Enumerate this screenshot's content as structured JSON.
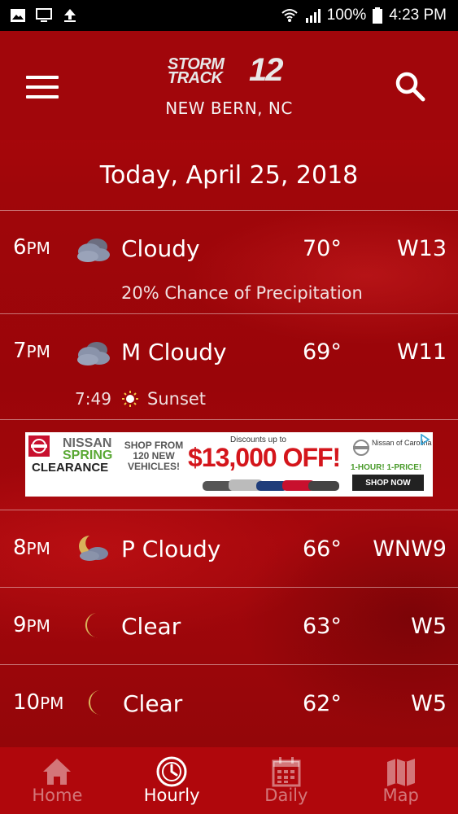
{
  "status_bar": {
    "battery": "100%",
    "time": "4:23 PM",
    "icons": [
      "image-icon",
      "monitor-icon",
      "upload-icon",
      "wifi-icon",
      "signal-icon",
      "battery-icon"
    ]
  },
  "header": {
    "logo_line1": "STORM",
    "logo_line2": "TRACK",
    "logo_number": "12",
    "location": "NEW BERN, NC"
  },
  "date_label": "Today, April 25, 2018",
  "hours": [
    {
      "hour": "6",
      "ampm": "PM",
      "icon": "partly-cloudy-icon",
      "condition": "Cloudy",
      "temp": "70°",
      "wind": "W13",
      "precip": "20% Chance of Precipitation"
    },
    {
      "hour": "7",
      "ampm": "PM",
      "icon": "partly-cloudy-icon",
      "condition": "M Cloudy",
      "temp": "69°",
      "wind": "W11",
      "sunset_time": "7:49",
      "sunset_label": "Sunset"
    },
    {
      "hour": "8",
      "ampm": "PM",
      "icon": "moon-cloud-icon",
      "condition": "P Cloudy",
      "temp": "66°",
      "wind": "WNW9"
    },
    {
      "hour": "9",
      "ampm": "PM",
      "icon": "moon-icon",
      "condition": "Clear",
      "temp": "63°",
      "wind": "W5"
    },
    {
      "hour": "10",
      "ampm": "PM",
      "icon": "moon-icon",
      "condition": "Clear",
      "temp": "62°",
      "wind": "W5"
    }
  ],
  "ad": {
    "brand1": "NISSAN",
    "brand2": "SPRING",
    "brand3": "CLEARANCE",
    "shop": "SHOP FROM 120 NEW VEHICLES!",
    "discount_label": "Discounts up to",
    "amount": "$13,000 OFF!",
    "dealer": "Nissan of Carolina",
    "promo": "1-HOUR! 1-PRICE!",
    "cta": "SHOP NOW"
  },
  "nav": [
    {
      "label": "Home",
      "icon": "home-icon",
      "active": false
    },
    {
      "label": "Hourly",
      "icon": "clock-icon",
      "active": true
    },
    {
      "label": "Daily",
      "icon": "calendar-icon",
      "active": false
    },
    {
      "label": "Map",
      "icon": "map-icon",
      "active": false
    }
  ],
  "colors": {
    "background": "#9a0509",
    "nav_background": "#b0070c",
    "ad_amount": "#d4151b",
    "moon": "#d9b25a"
  }
}
